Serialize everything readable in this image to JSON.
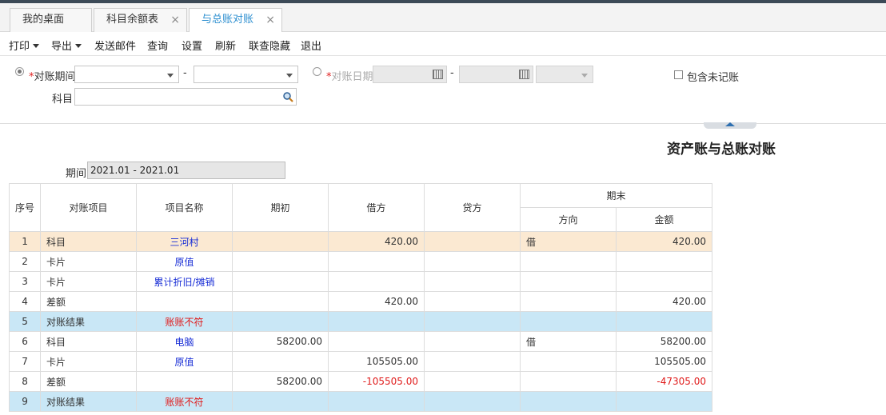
{
  "tabs": [
    {
      "label": "我的桌面"
    },
    {
      "label": "科目余额表",
      "close": "×"
    },
    {
      "label": "与总账对账",
      "close": "×"
    }
  ],
  "toolbar": {
    "print": "打印",
    "export": "导出",
    "send_mail": "发送邮件",
    "query": "查询",
    "settings": "设置",
    "refresh": "刷新",
    "hide_linked": "联查隐藏",
    "exit": "退出"
  },
  "filter": {
    "required_mark": "*",
    "period_label": "对账期间",
    "period_from": "",
    "period_to": "",
    "range_dash": "-",
    "date_label": "对账日期",
    "date_from": "",
    "date_to": "",
    "date_extra": "",
    "subject_label": "科目",
    "subject_value": "",
    "include_unposted_label": "包含未记账"
  },
  "report": {
    "title": "资产账与总账对账",
    "period_label": "期间",
    "period_value": "2021.01 - 2021.01"
  },
  "table": {
    "headers": {
      "seq": "序号",
      "item": "对账项目",
      "name": "项目名称",
      "opening": "期初",
      "debit": "借方",
      "credit": "贷方",
      "ending": "期末",
      "direction": "方向",
      "amount": "金额"
    },
    "rows": [
      {
        "seq": "1",
        "item": "科目",
        "name": "三河村",
        "opening": "",
        "debit": "420.00",
        "credit": "",
        "direction": "借",
        "amount": "420.00"
      },
      {
        "seq": "2",
        "item": "卡片",
        "name": "原值",
        "opening": "",
        "debit": "",
        "credit": "",
        "direction": "",
        "amount": ""
      },
      {
        "seq": "3",
        "item": "卡片",
        "name": "累计折旧/摊销",
        "opening": "",
        "debit": "",
        "credit": "",
        "direction": "",
        "amount": ""
      },
      {
        "seq": "4",
        "item": "差额",
        "name": "",
        "opening": "",
        "debit": "420.00",
        "credit": "",
        "direction": "",
        "amount": "420.00"
      },
      {
        "seq": "5",
        "item": "对账结果",
        "name": "账账不符",
        "opening": "",
        "debit": "",
        "credit": "",
        "direction": "",
        "amount": ""
      },
      {
        "seq": "6",
        "item": "科目",
        "name": "电脑",
        "opening": "58200.00",
        "debit": "",
        "credit": "",
        "direction": "借",
        "amount": "58200.00"
      },
      {
        "seq": "7",
        "item": "卡片",
        "name": "原值",
        "opening": "",
        "debit": "105505.00",
        "credit": "",
        "direction": "",
        "amount": "105505.00"
      },
      {
        "seq": "8",
        "item": "差额",
        "name": "",
        "opening": "58200.00",
        "debit": "-105505.00",
        "credit": "",
        "direction": "",
        "amount": "-47305.00"
      },
      {
        "seq": "9",
        "item": "对账结果",
        "name": "账账不符",
        "opening": "",
        "debit": "",
        "credit": "",
        "direction": "",
        "amount": ""
      }
    ]
  },
  "colors": {
    "selected_row": "#fbe9d2",
    "result_row": "#c9e7f6",
    "link_blue": "#1a2fd6",
    "negative_red": "#e01b1b",
    "active_tab": "#2d8fd0"
  }
}
